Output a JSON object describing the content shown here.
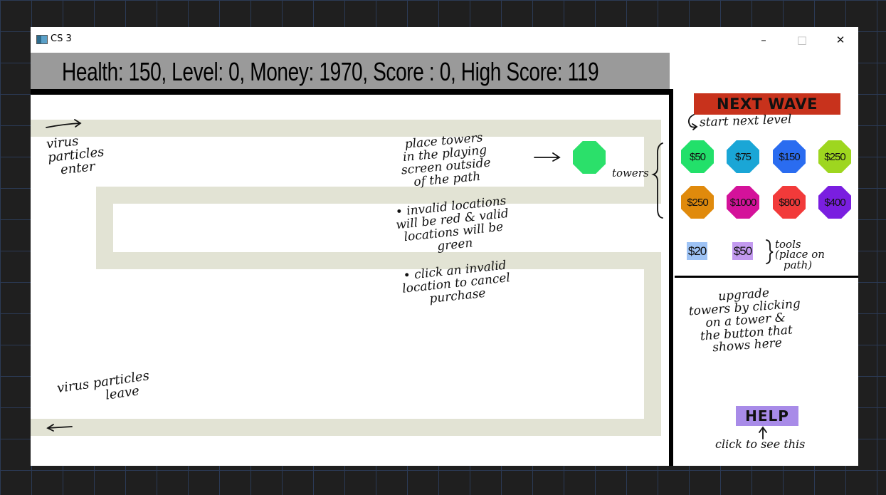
{
  "window": {
    "title": "CS 3",
    "minimize": "–",
    "maximize": "□",
    "close": "✕"
  },
  "hud": {
    "text": "Health: 150, Level: 0, Money: 1970, Score : 0, High Score: 119"
  },
  "sidebar": {
    "next_wave": "NEXT WAVE",
    "towers": [
      {
        "price": "$50",
        "color": "#22e06a"
      },
      {
        "price": "$75",
        "color": "#1aa6d6"
      },
      {
        "price": "$150",
        "color": "#2a6cf0"
      },
      {
        "price": "$250",
        "color": "#9ed61f"
      },
      {
        "price": "$250",
        "color": "#e08a0c"
      },
      {
        "price": "$1000",
        "color": "#d4129a"
      },
      {
        "price": "$800",
        "color": "#f23a3a"
      },
      {
        "price": "$400",
        "color": "#7a1ee0"
      }
    ],
    "tools": [
      {
        "price": "$20",
        "color": "#9ec3f5"
      },
      {
        "price": "$50",
        "color": "#c39af0"
      }
    ],
    "help": "HELP"
  },
  "annotations": {
    "enter": [
      "virus",
      "particles",
      "enter"
    ],
    "leave": [
      "virus particles",
      "leave"
    ],
    "place": [
      "place towers",
      "in the playing",
      "screen outside",
      "of the path"
    ],
    "invalid": [
      "• invalid locations",
      "will be red & valid",
      "locations will be",
      "green"
    ],
    "cancel": [
      "• click an invalid",
      "location to cancel",
      "purchase"
    ],
    "towers": "towers",
    "start": "start next level",
    "tools": [
      "tools",
      "(place on",
      "path)"
    ],
    "upgrade": [
      "upgrade",
      "towers by clicking",
      "on a tower &",
      "the button that",
      "shows here"
    ],
    "help_hint": "click to see this"
  },
  "colors": {
    "path": "#e2e3d4",
    "hud_bg": "#9a9a9a",
    "next_wave_bg": "#c8321c",
    "help_bg": "#a88be8",
    "preview_tower": "#2be06a"
  }
}
